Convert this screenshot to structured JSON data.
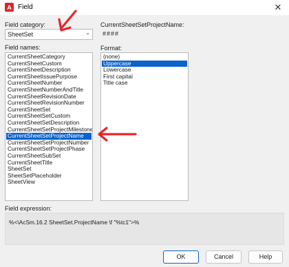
{
  "window": {
    "title": "Field",
    "app_icon_letter": "A",
    "close_glyph": "✕"
  },
  "field_category": {
    "label": "Field category:",
    "value": "SheetSet",
    "chevron": "⌄"
  },
  "field_preview": {
    "label": "CurrentSheetSetProjectName:",
    "value": "####"
  },
  "field_names": {
    "label": "Field names:",
    "items": [
      "CurrentSheetCategory",
      "CurrentSheetCustom",
      "CurrentSheetDescription",
      "CurrentSheetIssuePurpose",
      "CurrentSheetNumber",
      "CurrentSheetNumberAndTitle",
      "CurrentSheetRevisionDate",
      "CurrentSheetRevisionNumber",
      "CurrentSheetSet",
      "CurrentSheetSetCustom",
      "CurrentSheetSetDescription",
      "CurrentSheetSetProjectMilestone",
      "CurrentSheetSetProjectName",
      "CurrentSheetSetProjectNumber",
      "CurrentSheetSetProjectPhase",
      "CurrentSheetSubSet",
      "CurrentSheetTitle",
      "SheetSet",
      "SheetSetPlaceholder",
      "SheetView"
    ],
    "selected_index": 12
  },
  "format": {
    "label": "Format:",
    "items": [
      "(none)",
      "Uppercase",
      "Lowercase",
      "First capital",
      "Title case"
    ],
    "selected_index": 1
  },
  "field_expression": {
    "label": "Field expression:",
    "value": "%<\\AcSm.16.2 SheetSet.ProjectName \\f \"%tc1\">%"
  },
  "buttons": {
    "ok": "OK",
    "cancel": "Cancel",
    "help": "Help"
  },
  "colors": {
    "selection": "#0b63cc",
    "annotation_arrow": "#e8232a",
    "app_icon": "#d9262e"
  }
}
